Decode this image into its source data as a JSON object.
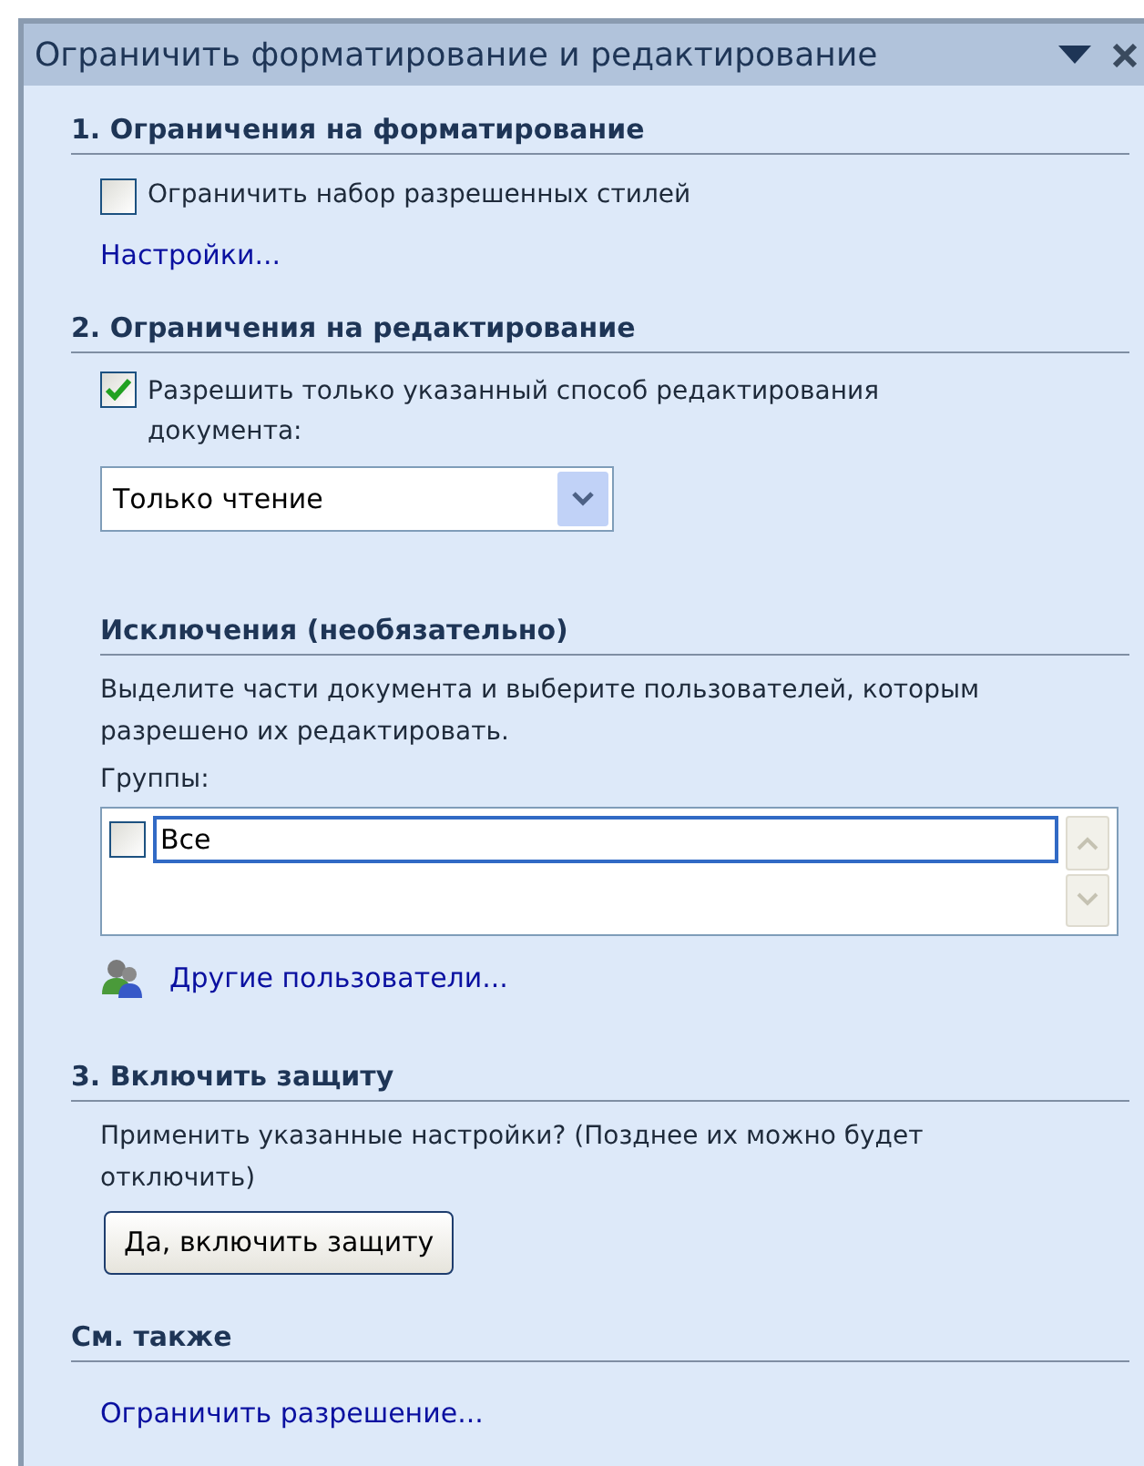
{
  "title": "Ограничить форматирование и редактирование",
  "formatting": {
    "heading": "1. Ограничения на форматирование",
    "checkbox": {
      "label": "Ограничить набор разрешенных стилей",
      "checked": false
    },
    "link": "Настройки..."
  },
  "editing": {
    "heading": "2. Ограничения на редактирование",
    "checkbox": {
      "label": "Разрешить только указанный способ редактирования документа:",
      "checked": true
    },
    "select": {
      "value": "Только чтение"
    }
  },
  "exceptions": {
    "heading": "Исключения (необязательно)",
    "description": "Выделите части документа и выберите пользователей, которым разрешено их редактировать.",
    "groups_label": "Группы:",
    "groups": [
      {
        "label": "Все",
        "checked": false,
        "selected": true
      }
    ],
    "link": "Другие пользователи..."
  },
  "protection": {
    "heading": "3. Включить защиту",
    "description": "Применить указанные настройки? (Позднее их можно будет отключить)",
    "button": "Да, включить защиту"
  },
  "see_also": {
    "heading": "См. также",
    "link": "Ограничить разрешение..."
  }
}
